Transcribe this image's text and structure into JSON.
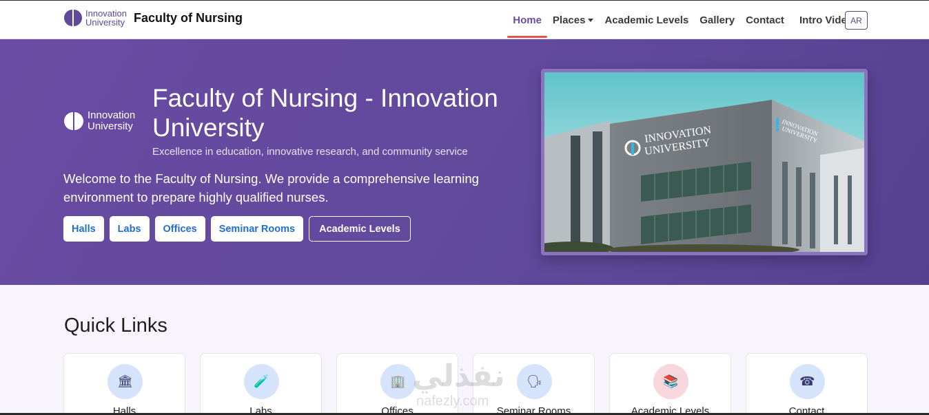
{
  "navbar": {
    "brand_line1": "Innovation",
    "brand_line2": "University",
    "brand_title": "Faculty of Nursing",
    "items": [
      {
        "label": "Home"
      },
      {
        "label": "Places"
      },
      {
        "label": "Academic Levels"
      },
      {
        "label": "Gallery"
      },
      {
        "label": "Contact"
      },
      {
        "label": "Intro Video"
      }
    ],
    "lang_button": "AR"
  },
  "hero": {
    "logo_line1": "Innovation",
    "logo_line2": "University",
    "title": "Faculty of Nursing - Innovation University",
    "subtitle": "Excellence in education, innovative research, and community service",
    "description": "Welcome to the Faculty of Nursing. We provide a comprehensive learning environment to prepare highly qualified nurses.",
    "buttons": [
      {
        "label": "Halls"
      },
      {
        "label": "Labs"
      },
      {
        "label": "Offices"
      },
      {
        "label": "Seminar Rooms"
      }
    ],
    "outline_button": "Academic Levels",
    "building_sign_line1": "INNOVATION",
    "building_sign_line2": "UNIVERSITY"
  },
  "quick_links": {
    "title": "Quick Links",
    "cards": [
      {
        "label": "Halls",
        "icon": "🏛"
      },
      {
        "label": "Labs",
        "icon": "🧪"
      },
      {
        "label": "Offices",
        "icon": "🏢"
      },
      {
        "label": "Seminar Rooms",
        "icon": "🗣"
      },
      {
        "label": "Academic Levels",
        "icon": "📚"
      },
      {
        "label": "Contact",
        "icon": "☎"
      }
    ]
  },
  "watermark": {
    "text": "نفذلي",
    "sub": "nafezly.com"
  }
}
